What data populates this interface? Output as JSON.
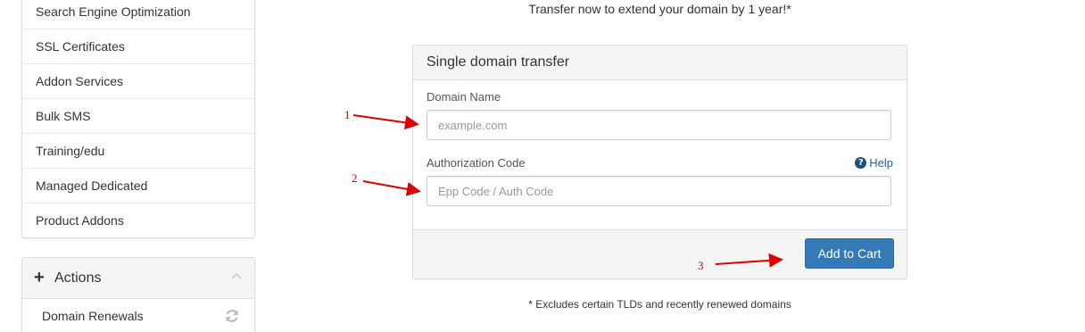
{
  "sidebar": {
    "items": [
      {
        "label": "Search Engine Optimization"
      },
      {
        "label": "SSL Certificates"
      },
      {
        "label": "Addon Services"
      },
      {
        "label": "Bulk SMS"
      },
      {
        "label": "Training/edu"
      },
      {
        "label": "Managed Dedicated"
      },
      {
        "label": "Product Addons"
      }
    ]
  },
  "actions": {
    "plus_icon": "plus-icon",
    "title": "Actions",
    "collapse_icon": "chevron-up-icon",
    "items": [
      {
        "label": "Domain Renewals",
        "icon": "refresh-icon"
      }
    ]
  },
  "main": {
    "headline": "Transfer now to extend your domain by 1 year!*",
    "panel": {
      "title": "Single domain transfer",
      "domain_label": "Domain Name",
      "domain_placeholder": "example.com",
      "domain_value": "",
      "auth_label": "Authorization Code",
      "auth_placeholder": "Epp Code / Auth Code",
      "auth_value": "",
      "help_icon": "question-circle-icon",
      "help_label": "Help",
      "submit_label": "Add to Cart"
    },
    "footnote": "* Excludes certain TLDs and recently renewed domains"
  },
  "annotations": {
    "arrow_color": "#dd0000",
    "labels": [
      "1",
      "2",
      "3"
    ]
  },
  "colors": {
    "primary_button": "#337ab7",
    "panel_header_bg": "#f5f5f5",
    "help_link": "#2a6496"
  }
}
